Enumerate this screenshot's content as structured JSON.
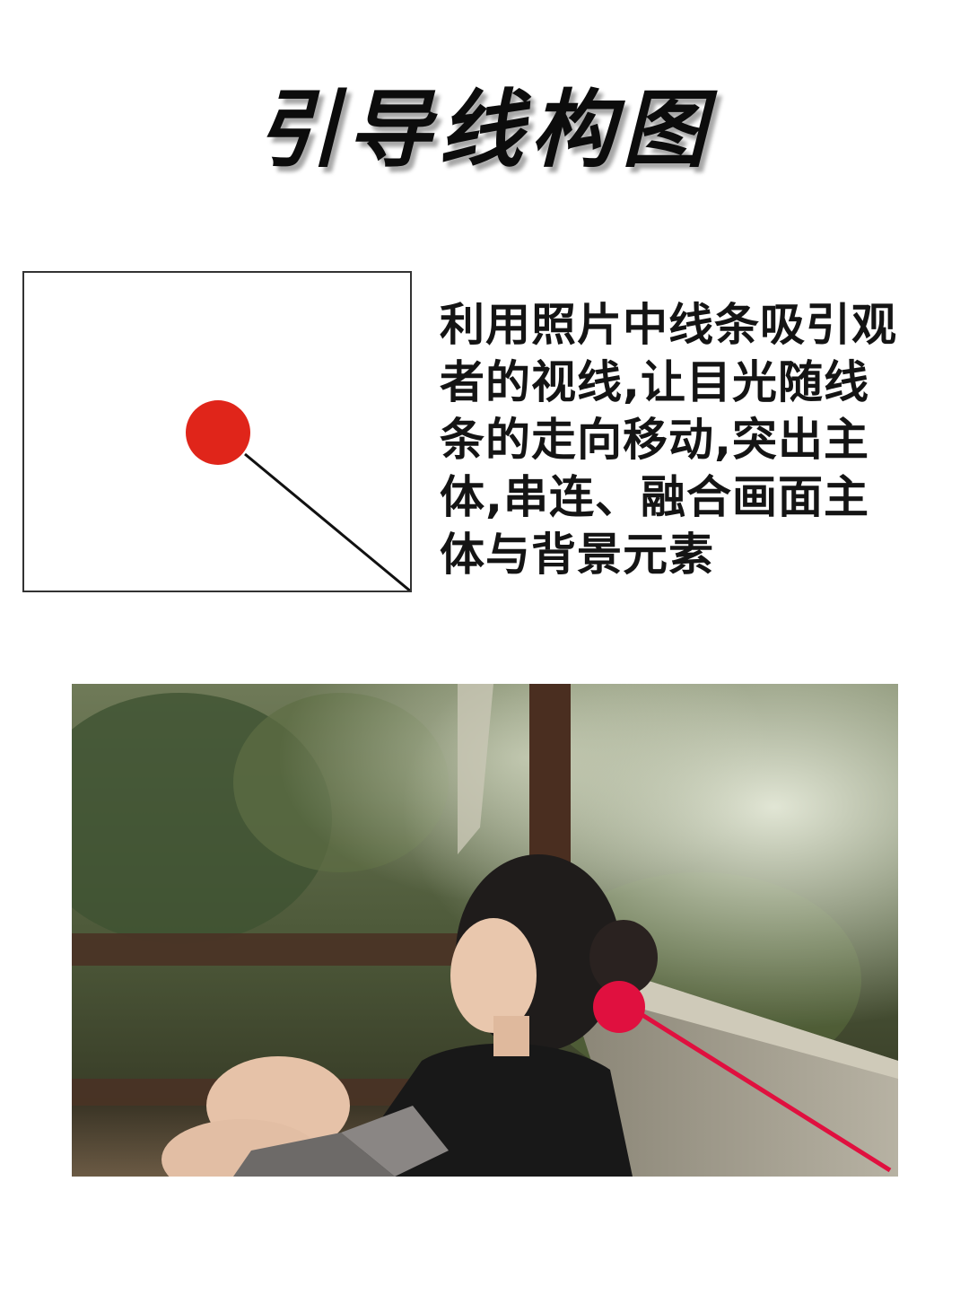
{
  "title": "引导线构图",
  "description": {
    "lines": [
      "利用照片中线条吸引观",
      "者的视线,让目光随线",
      "条的走向移动,突出主",
      "体,串连、融合画面主",
      "体与背景元素"
    ]
  },
  "colors": {
    "diagram_dot": "#e0251a",
    "photo_dot": "#e0103f",
    "text": "#141414"
  },
  "photo": {
    "description_icon": "photo-icon"
  }
}
